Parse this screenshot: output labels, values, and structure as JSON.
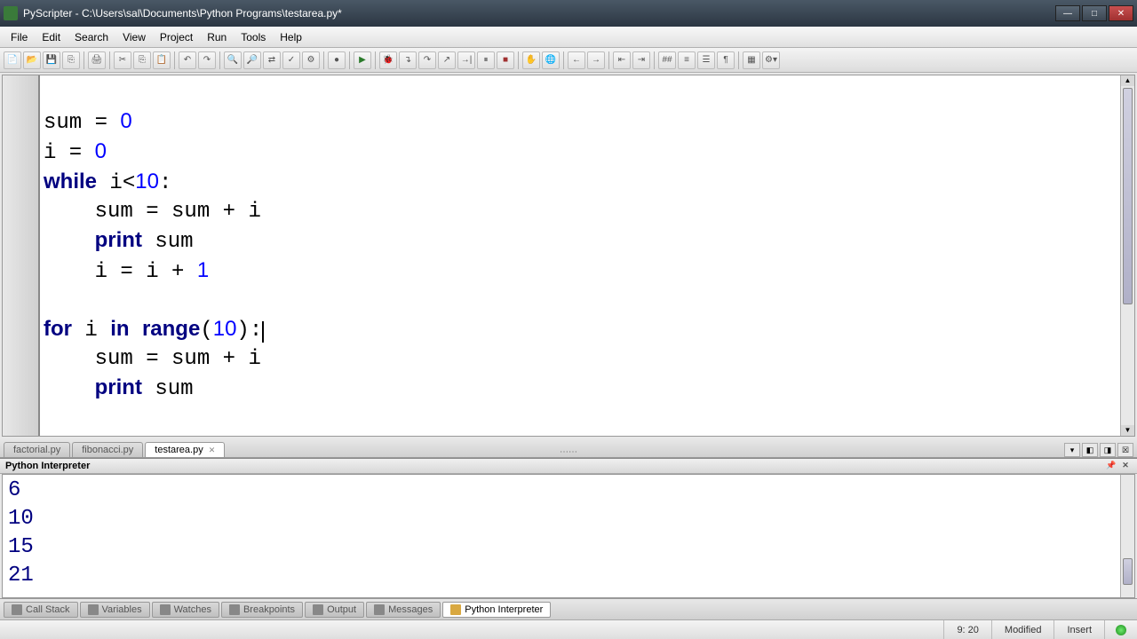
{
  "title": "PyScripter - C:\\Users\\sal\\Documents\\Python Programs\\testarea.py*",
  "menu": [
    "File",
    "Edit",
    "Search",
    "View",
    "Project",
    "Run",
    "Tools",
    "Help"
  ],
  "code_lines": [
    "",
    "sum = 0",
    "i = 0",
    "while i<10:",
    "    sum = sum + i",
    "    print sum",
    "    i = i + 1",
    "",
    "for i in range(10):",
    "    sum = sum + i",
    "    print sum"
  ],
  "tabs": {
    "inactive": [
      "factorial.py",
      "fibonacci.py"
    ],
    "active": "testarea.py"
  },
  "interpreter_panel_title": "Python Interpreter",
  "interpreter_output": [
    "6",
    "10",
    "15",
    "21"
  ],
  "bottom_tabs": [
    "Call Stack",
    "Variables",
    "Watches",
    "Breakpoints",
    "Output",
    "Messages",
    "Python Interpreter"
  ],
  "status": {
    "pos": "9: 20",
    "modified": "Modified",
    "mode": "Insert"
  }
}
